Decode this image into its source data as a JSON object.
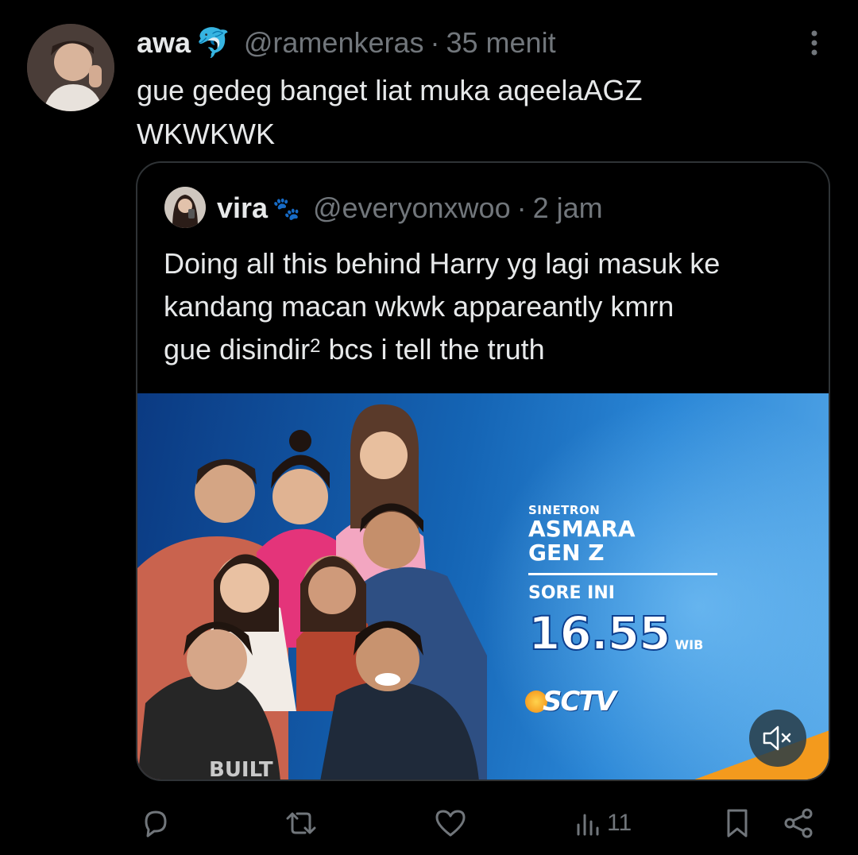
{
  "tweet": {
    "display_name": "awa",
    "name_emoji": "🐬",
    "handle": "@ramenkeras",
    "separator": "·",
    "time": "35 menit",
    "text_line1": "gue gedeg banget liat muka aqeelaAGZ",
    "text_line2": "WKWKWK"
  },
  "quote": {
    "display_name": "vira",
    "name_emoji": "🐾",
    "handle": "@everyonxwoo",
    "separator": "·",
    "time": "2 jam",
    "text_line1": "Doing all this behind Harry yg lagi masuk ke",
    "text_line2": "kandang macan wkwk appareantly kmrn",
    "text_line3_pre": "gue disindir",
    "text_line3_sup": "2",
    "text_line3_post": " bcs i tell the truth"
  },
  "media": {
    "label_sinetron": "SINETRON",
    "title_line1": "ASMARA",
    "title_line2": "GEN Z",
    "sore_ini": "SORE INI",
    "time": "16.55",
    "wib": "WIB",
    "channel": "SCTV",
    "overprint": "BUILT",
    "accent": "#f39a1d"
  },
  "actions": {
    "views_count": "11"
  },
  "colors": {
    "background": "#000000",
    "text": "#e7e9ea",
    "secondary": "#71767b",
    "border": "#2f3336"
  }
}
